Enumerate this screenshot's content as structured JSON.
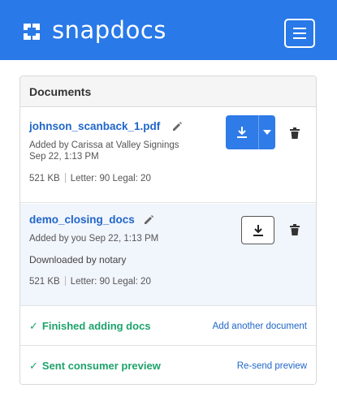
{
  "header": {
    "brand": "snapdocs",
    "colors": {
      "bar": "#2979e8",
      "text": "#ffffff"
    },
    "menu_icon": "hamburger-menu-icon"
  },
  "documents_panel": {
    "title": "Documents",
    "items": [
      {
        "name": "johnson_scanback_1.pdf",
        "added": "Added by Carissa at Valley Signings",
        "date": "Sep 22, 1:13 PM",
        "size": "521 KB",
        "letter": "Letter: 90",
        "legal": "Legal: 20",
        "download_style": "primary-split"
      },
      {
        "name": "demo_closing_docs",
        "added": "Added by you Sep 22, 1:13 PM",
        "note": "Downloaded by notary",
        "size": "521 KB",
        "letter": "Letter: 90",
        "legal": "Legal: 20",
        "download_style": "outline"
      }
    ]
  },
  "status": [
    {
      "text": "Finished adding docs",
      "link": "Add another document"
    },
    {
      "text": "Sent consumer preview",
      "link": "Re-send preview"
    }
  ],
  "colors": {
    "link": "#2066c9",
    "success": "#1ea36b",
    "primary_button": "#2f7be8"
  }
}
